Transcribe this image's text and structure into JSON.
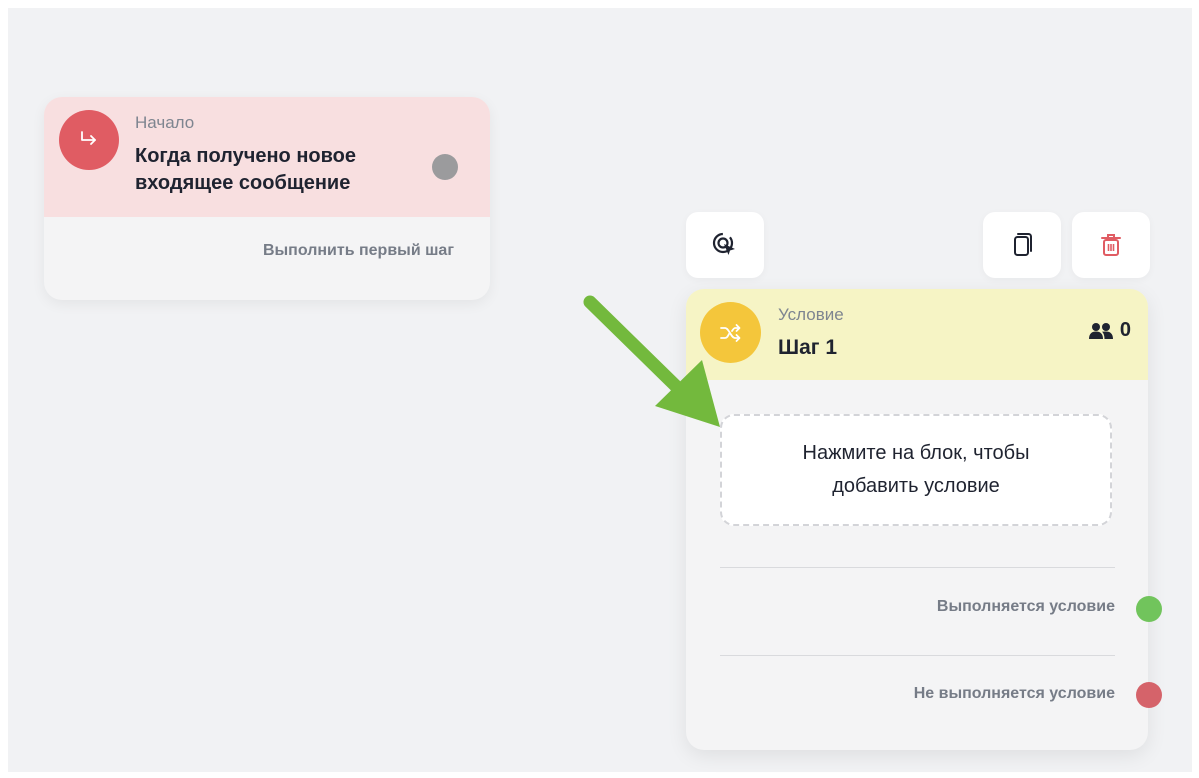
{
  "start_node": {
    "type_label": "Начало",
    "title": "Когда получено новое входящее сообщение",
    "output_label": "Выполнить первый шаг",
    "icon": "redirect-arrow-icon"
  },
  "toolbar": {
    "target_icon": "target-cursor-icon",
    "copy_icon": "copy-icon",
    "delete_icon": "trash-icon"
  },
  "condition_node": {
    "type_label": "Условие",
    "title": "Шаг 1",
    "users_count": "0",
    "add_condition_text": "Нажмите на блок, чтобы добавить условие",
    "output_true_label": "Выполняется условие",
    "output_false_label": "Не выполняется условие",
    "icon": "shuffle-icon"
  },
  "colors": {
    "start_header": "#f8dfe0",
    "start_icon": "#e05c63",
    "condition_header": "#f6f4c5",
    "condition_icon": "#f4c63b",
    "true_dot": "#71c45c",
    "false_dot": "#d5636a",
    "arrow": "#73b93d"
  }
}
